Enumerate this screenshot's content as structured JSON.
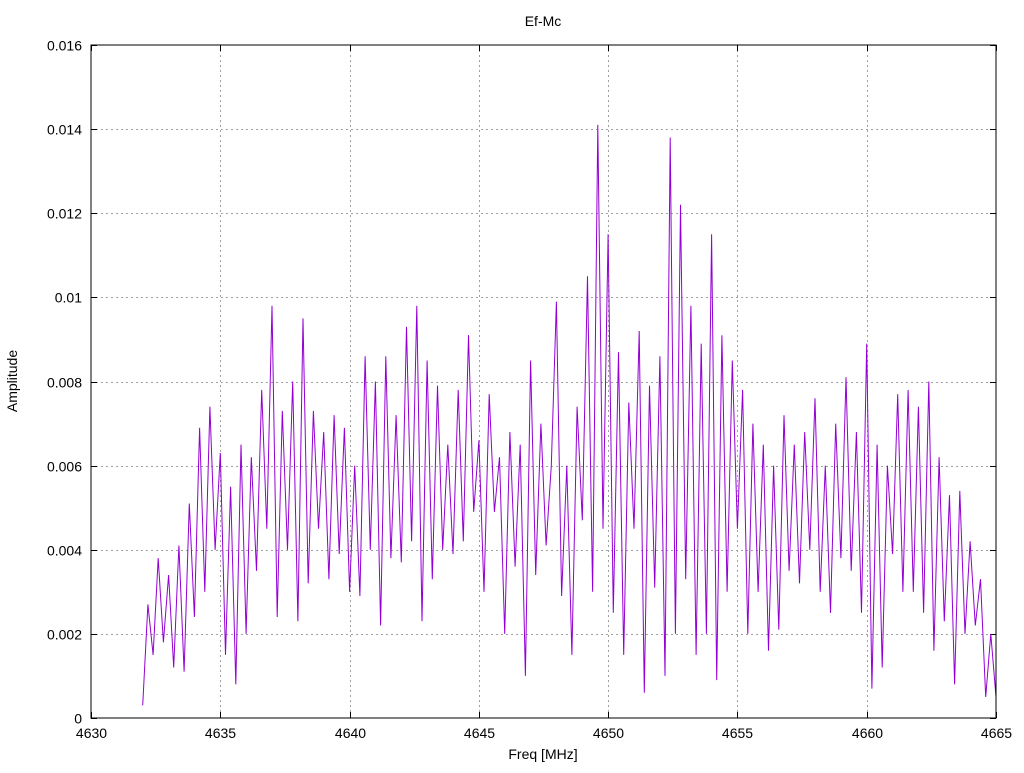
{
  "chart_data": {
    "type": "line",
    "title": "Ef-Mc",
    "xlabel": "Freq [MHz]",
    "ylabel": "Amplitude",
    "xlim": [
      4630,
      4665
    ],
    "ylim": [
      0,
      0.016
    ],
    "xticks": [
      "4630",
      "4635",
      "4640",
      "4645",
      "4650",
      "4655",
      "4660",
      "4665"
    ],
    "xtick_values": [
      4630,
      4635,
      4640,
      4645,
      4650,
      4655,
      4660,
      4665
    ],
    "yticks": [
      "0",
      "0.002",
      "0.004",
      "0.006",
      "0.008",
      "0.01",
      "0.012",
      "0.014",
      "0.016"
    ],
    "ytick_values": [
      0,
      0.002,
      0.004,
      0.006,
      0.008,
      0.01,
      0.012,
      0.014,
      0.016
    ],
    "grid": true,
    "line_color": "#9400D3",
    "x_start": 4632.0,
    "x_step": 0.2,
    "values": [
      0.0003,
      0.0027,
      0.0015,
      0.0038,
      0.0018,
      0.0034,
      0.0012,
      0.0041,
      0.0011,
      0.0051,
      0.0024,
      0.0069,
      0.003,
      0.0074,
      0.004,
      0.0063,
      0.0015,
      0.0055,
      0.0008,
      0.0065,
      0.002,
      0.0062,
      0.0035,
      0.0078,
      0.0045,
      0.0098,
      0.0024,
      0.0073,
      0.004,
      0.008,
      0.0023,
      0.0095,
      0.0032,
      0.0073,
      0.0045,
      0.0068,
      0.0033,
      0.0072,
      0.0039,
      0.0069,
      0.003,
      0.006,
      0.0029,
      0.0086,
      0.004,
      0.008,
      0.0022,
      0.0086,
      0.0038,
      0.0072,
      0.0037,
      0.0093,
      0.0042,
      0.0098,
      0.0023,
      0.0085,
      0.0033,
      0.0079,
      0.004,
      0.0065,
      0.0039,
      0.0078,
      0.0042,
      0.0091,
      0.0049,
      0.0066,
      0.003,
      0.0077,
      0.0049,
      0.0062,
      0.002,
      0.0068,
      0.0036,
      0.0065,
      0.001,
      0.0085,
      0.0034,
      0.007,
      0.0041,
      0.006,
      0.0099,
      0.0029,
      0.006,
      0.0015,
      0.0074,
      0.0047,
      0.0105,
      0.003,
      0.0141,
      0.0045,
      0.0115,
      0.0025,
      0.0087,
      0.0015,
      0.0075,
      0.0045,
      0.0092,
      0.0006,
      0.0079,
      0.0031,
      0.0086,
      0.001,
      0.0138,
      0.002,
      0.0122,
      0.0033,
      0.0098,
      0.0015,
      0.0089,
      0.002,
      0.0115,
      0.0009,
      0.0091,
      0.003,
      0.0085,
      0.0045,
      0.0078,
      0.002,
      0.007,
      0.003,
      0.0065,
      0.0016,
      0.006,
      0.0021,
      0.0072,
      0.0035,
      0.0065,
      0.0032,
      0.0068,
      0.004,
      0.0076,
      0.003,
      0.006,
      0.0025,
      0.007,
      0.0038,
      0.0081,
      0.0035,
      0.0068,
      0.0025,
      0.0089,
      0.0007,
      0.0065,
      0.0012,
      0.006,
      0.0039,
      0.0077,
      0.003,
      0.0078,
      0.003,
      0.0074,
      0.0025,
      0.008,
      0.0016,
      0.0062,
      0.0023,
      0.0053,
      0.0008,
      0.0054,
      0.002,
      0.0042,
      0.0022,
      0.0033,
      0.0005,
      0.002,
      0.0005
    ]
  }
}
